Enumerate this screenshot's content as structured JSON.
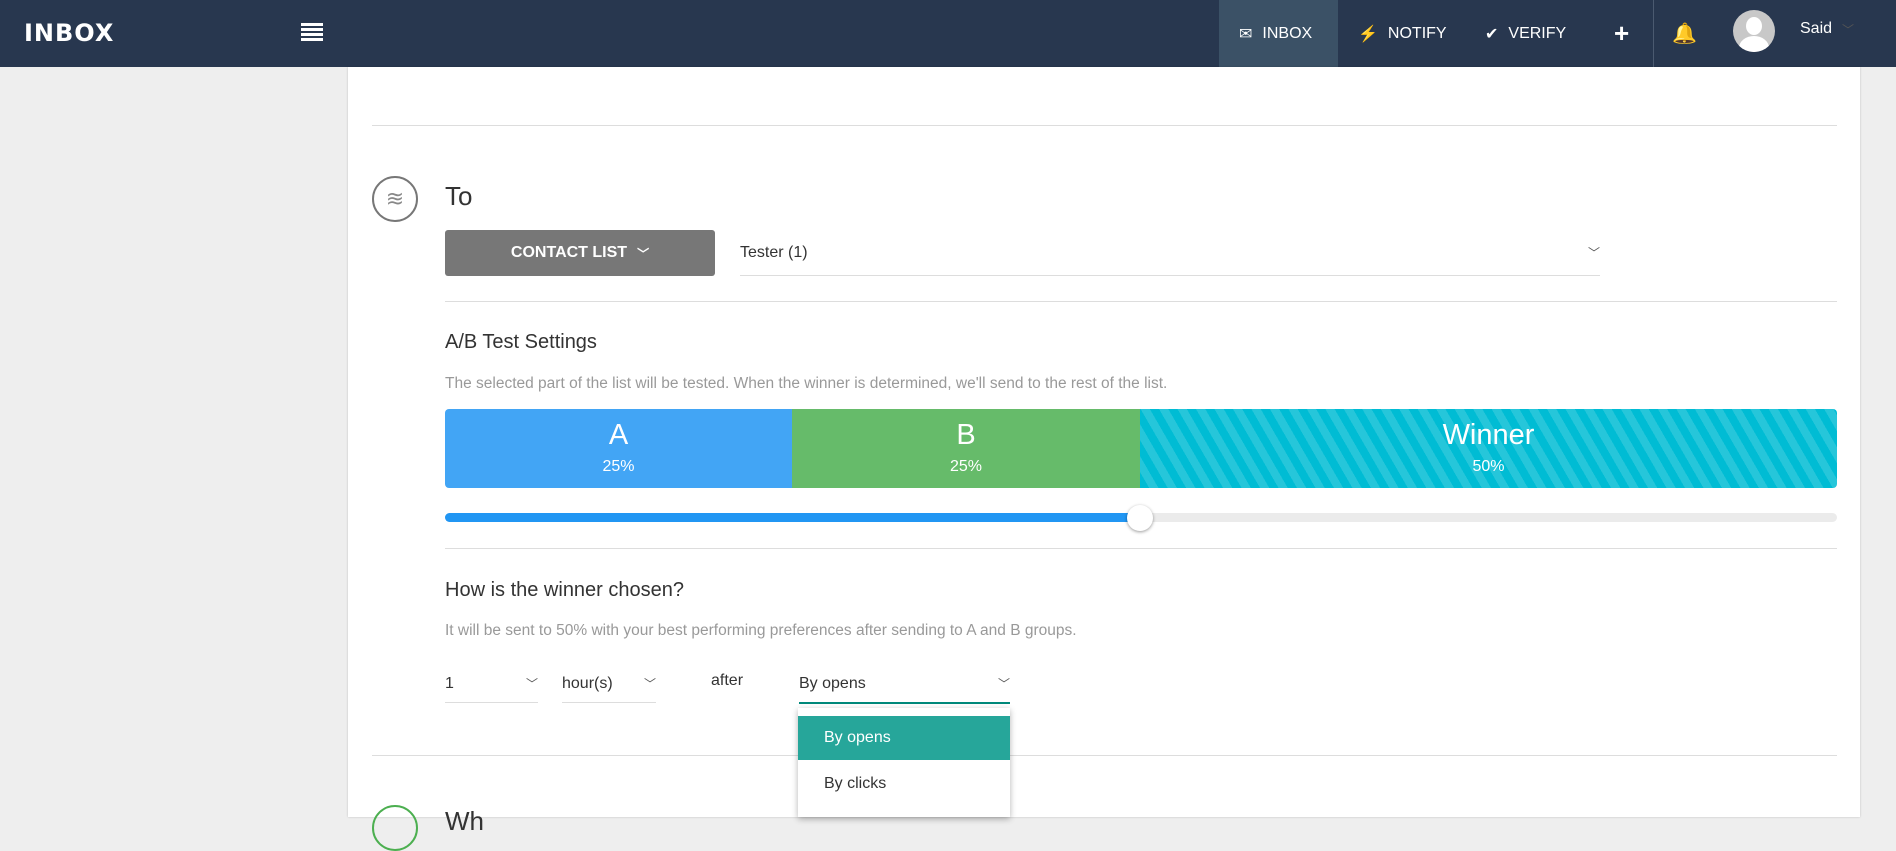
{
  "header": {
    "logo": "INBOX",
    "nav": [
      {
        "label": "INBOX",
        "icon": "envelope-icon",
        "active": true
      },
      {
        "label": "NOTIFY",
        "icon": "lightning-icon"
      },
      {
        "label": "VERIFY",
        "icon": "check-icon"
      }
    ],
    "add": "+",
    "user": "Said"
  },
  "to": {
    "title": "To",
    "contact_button": "CONTACT LIST",
    "list_value": "Tester (1)"
  },
  "ab": {
    "title": "A/B Test Settings",
    "description": "The selected part of the list will be tested. When the winner is determined, we'll send to the rest of the list.",
    "segments": [
      {
        "label": "A",
        "percent": "25%",
        "color": "#42a5f5"
      },
      {
        "label": "B",
        "percent": "25%",
        "color": "#66bb6a"
      },
      {
        "label": "Winner",
        "percent": "50%",
        "color": "#00bcd4"
      }
    ],
    "slider_value": 50
  },
  "winner": {
    "title": "How is the winner chosen?",
    "description": "It will be sent to 50% with your best performing preferences after sending to A and B groups.",
    "amount": "1",
    "unit": "hour(s)",
    "after": "after",
    "criterion": "By opens",
    "options": [
      "By opens",
      "By clicks"
    ]
  },
  "next_section": {
    "title": "Wh"
  }
}
